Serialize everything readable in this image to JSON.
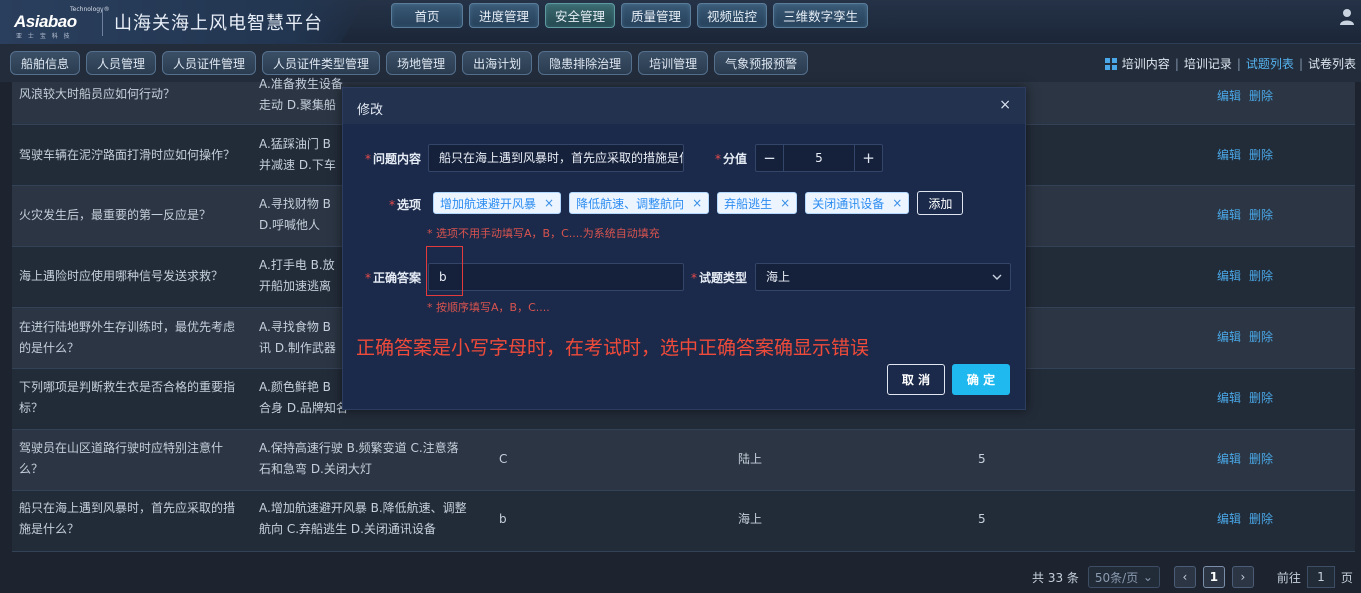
{
  "app": {
    "brand": "Asiabao",
    "brand_sup": "Technology®",
    "brand_sub": "亚 士 宝 科 技",
    "title": "山海关海上风电智慧平台"
  },
  "topnav": [
    "首页",
    "进度管理",
    "安全管理",
    "质量管理",
    "视频监控",
    "三维数字孪生"
  ],
  "subnav": {
    "items": [
      "船舶信息",
      "人员管理",
      "人员证件管理",
      "人员证件类型管理",
      "场地管理",
      "出海计划",
      "隐患排除治理",
      "培训管理",
      "气象预报预警"
    ],
    "right_links": [
      "培训内容",
      "培训记录",
      "试题列表",
      "试卷列表"
    ],
    "active_right": "试题列表"
  },
  "table": {
    "rows": [
      {
        "q1": "风浪较大时船员应如何行动？",
        "q2": "",
        "o1": "A.准备救生设备",
        "o2": "走动  D.聚集船",
        "ans": "",
        "type": "",
        "score": ""
      },
      {
        "q1": "驾驶车辆在泥泞路面打滑时应如何操作？",
        "q2": "",
        "o1": "A.猛踩油门  B",
        "o2": "并减速  D.下车",
        "ans": "",
        "type": "",
        "score": ""
      },
      {
        "q1": "火灾发生后，最重要的第一反应是？",
        "q2": "",
        "o1": "A.寻找财物  B",
        "o2": "D.呼喊他人",
        "ans": "",
        "type": "",
        "score": ""
      },
      {
        "q1": "海上遇险时应使用哪种信号发送求救？",
        "q2": "",
        "o1": "A.打手电  B.放",
        "o2": "开船加速逃离",
        "ans": "",
        "type": "",
        "score": ""
      },
      {
        "q1": "在进行陆地野外生存训练时，最优先考虑",
        "q2": "的是什么？",
        "o1": "A.寻找食物  B",
        "o2": "讯  D.制作武器",
        "ans": "",
        "type": "",
        "score": ""
      },
      {
        "q1": "下列哪项是判断救生衣是否合格的重要指",
        "q2": "标？",
        "o1": "A.颜色鲜艳  B",
        "o2": "合身  D.品牌知名",
        "ans": "",
        "type": "",
        "score": ""
      },
      {
        "q1": "驾驶员在山区道路行驶时应特别注意什",
        "q2": "么？",
        "o1": "A.保持高速行驶  B.频繁变道  C.注意落",
        "o2": "石和急弯  D.关闭大灯",
        "ans": "C",
        "type": "陆上",
        "score": "5"
      },
      {
        "q1": "船只在海上遇到风暴时，首先应采取的措",
        "q2": "施是什么？",
        "o1": "A.增加航速避开风暴  B.降低航速、调整",
        "o2": "航向  C.弃船逃生  D.关闭通讯设备",
        "ans": "b",
        "type": "海上",
        "score": "5"
      }
    ],
    "edit_label": "编辑",
    "delete_label": "删除"
  },
  "pager": {
    "total": "共 33 条",
    "page_size": "50条/页",
    "current": "1",
    "goto_prefix": "前往",
    "goto_value": "1",
    "goto_suffix": "页"
  },
  "modal": {
    "title": "修改",
    "close": "×",
    "question_label": "问题内容",
    "question_value": "船只在海上遇到风暴时，首先应采取的措施是什么？",
    "score_label": "分值",
    "score_value": "5",
    "options_label": "选项",
    "options": [
      "增加航速避开风暴",
      "降低航速、调整航向",
      "弃船逃生",
      "关闭通讯设备"
    ],
    "add_label": "添加",
    "options_hint": "* 选项不用手动填写A，B，C....为系统自动填充",
    "answer_label": "正确答案",
    "answer_value": "b",
    "answer_hint": "* 按顺序填写A，B，C....",
    "type_label": "试题类型",
    "type_value": "海上",
    "annotation": "正确答案是小写字母时，在考试时，选中正确答案确显示错误",
    "cancel_label": "取 消",
    "ok_label": "确 定"
  },
  "colors": {
    "accent": "#1fb9f0",
    "link": "#4aa8e8",
    "danger": "#e84b4b",
    "tag_text": "#2d8cf0"
  }
}
